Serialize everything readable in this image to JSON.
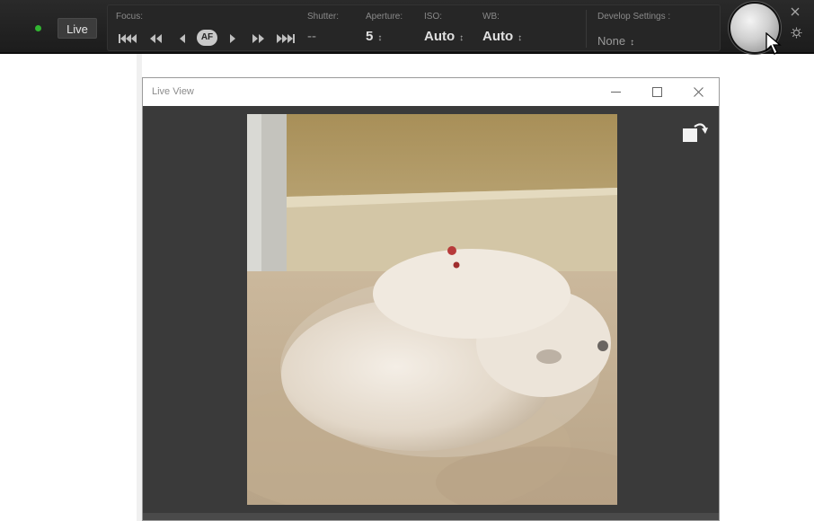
{
  "toolbar": {
    "live_label": "Live",
    "focus": {
      "label": "Focus:",
      "af_label": "AF"
    },
    "shutter": {
      "label": "Shutter:",
      "value": "--"
    },
    "aperture": {
      "label": "Aperture:",
      "value": "5"
    },
    "iso": {
      "label": "ISO:",
      "value": "Auto"
    },
    "wb": {
      "label": "WB:",
      "value": "Auto"
    },
    "develop": {
      "label": "Develop Settings :",
      "value": "None"
    },
    "spinner_glyph": "↕"
  },
  "window": {
    "title": "Live View",
    "controls": [
      "minimize",
      "maximize",
      "close"
    ]
  },
  "colors": {
    "live_indicator": "#31b531",
    "toolbar_bg": "#1c1c1c",
    "panel_bg": "#262626",
    "viewer_bg": "#3a3a3a"
  },
  "icons": [
    "focus-far-3-icon",
    "focus-far-2-icon",
    "focus-far-1-icon",
    "focus-near-1-icon",
    "focus-near-2-icon",
    "focus-near-3-icon",
    "shutter-release-icon",
    "close-icon",
    "settings-gear-icon",
    "rotate-icon",
    "mouse-cursor-icon"
  ]
}
